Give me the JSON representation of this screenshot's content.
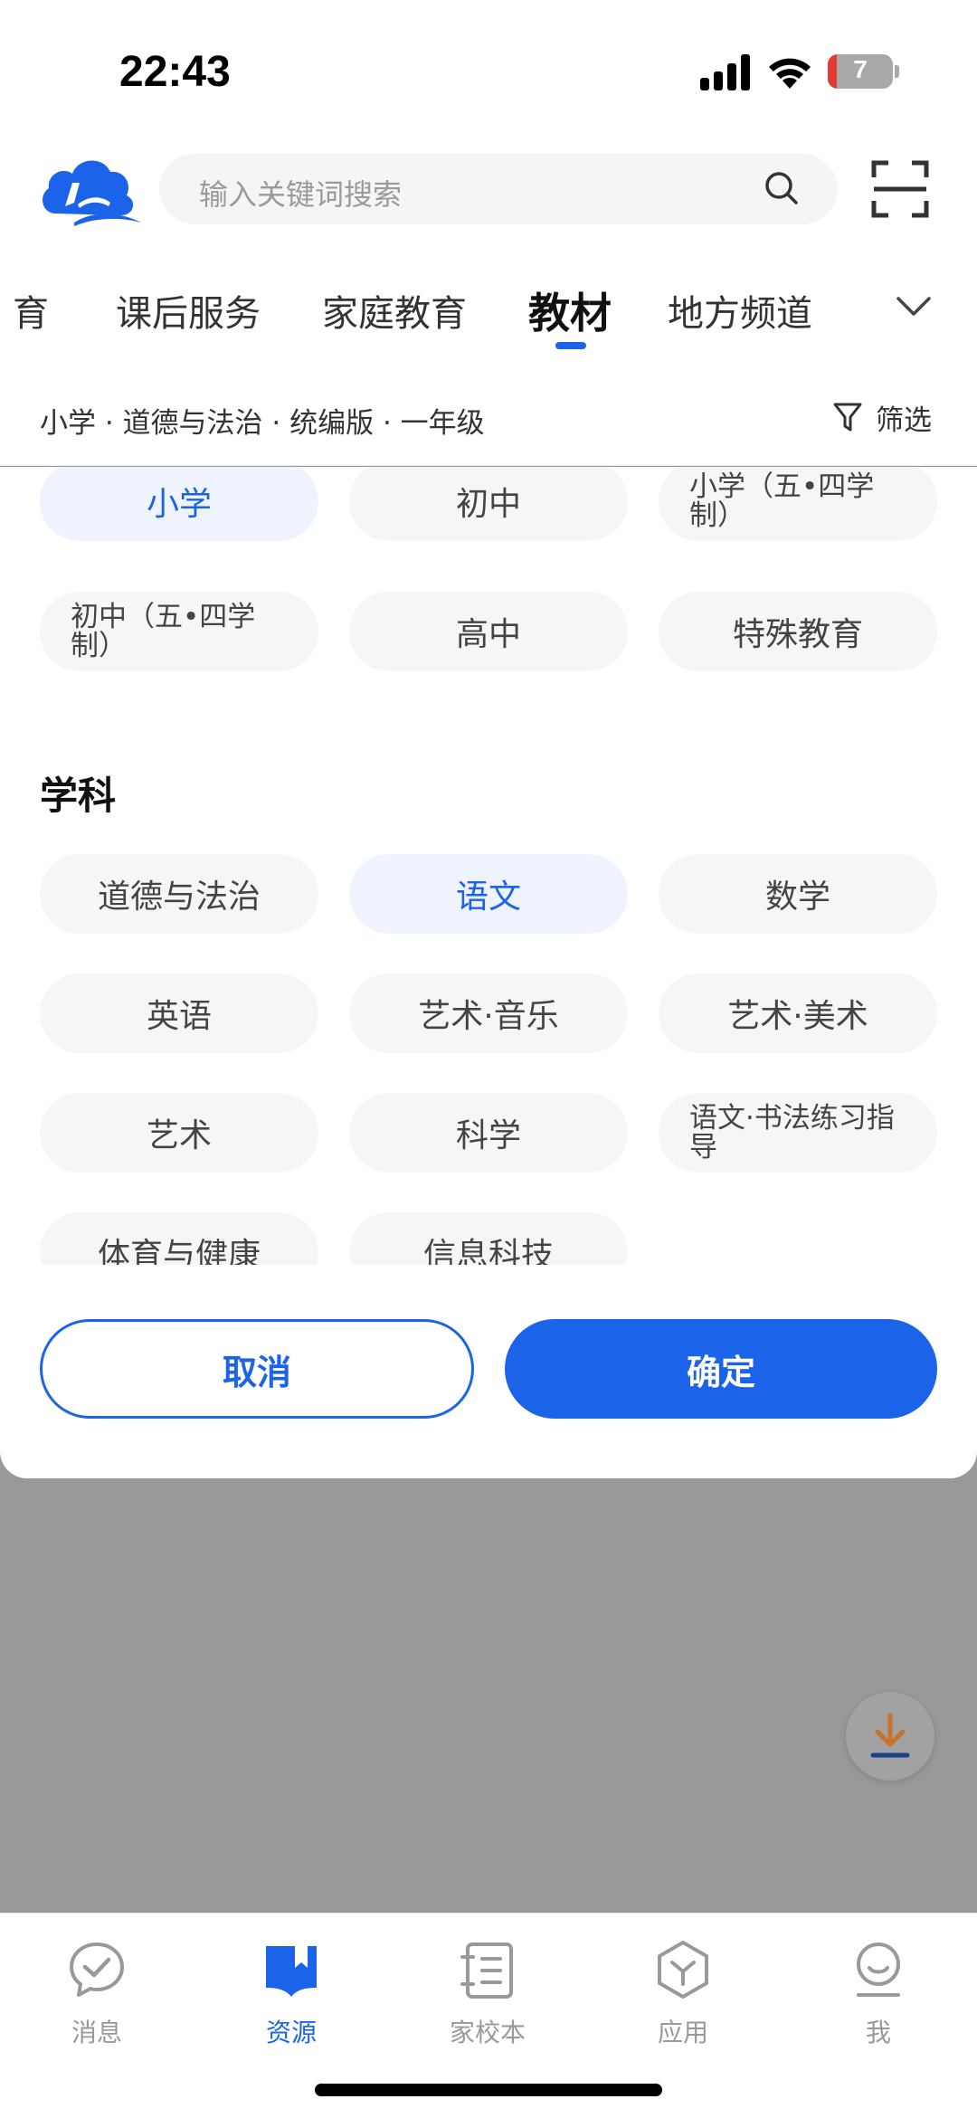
{
  "status_bar": {
    "time": "22:43",
    "battery": "7"
  },
  "search": {
    "placeholder": "输入关键词搜索"
  },
  "tabs": [
    {
      "label": "育"
    },
    {
      "label": "课后服务"
    },
    {
      "label": "家庭教育"
    },
    {
      "label": "教材",
      "active": true
    },
    {
      "label": "地方频道"
    }
  ],
  "filter": {
    "path": "小学 · 道德与法治 · 统编版 · 一年级",
    "label": "筛选"
  },
  "stage_options": [
    {
      "label": "小学",
      "selected": true
    },
    {
      "label": "初中"
    },
    {
      "label": "小学（五•四学制）"
    },
    {
      "label": "初中（五•四学制）"
    },
    {
      "label": "高中"
    },
    {
      "label": "特殊教育"
    }
  ],
  "subject_section": {
    "title": "学科"
  },
  "subject_options": [
    {
      "label": "道德与法治"
    },
    {
      "label": "语文",
      "selected": true
    },
    {
      "label": "数学"
    },
    {
      "label": "英语"
    },
    {
      "label": "艺术·音乐"
    },
    {
      "label": "艺术·美术"
    },
    {
      "label": "艺术"
    },
    {
      "label": "科学"
    },
    {
      "label": "语文·书法练习指导"
    },
    {
      "label": "体育与健康"
    },
    {
      "label": "信息科技"
    }
  ],
  "actions": {
    "cancel": "取消",
    "confirm": "确定"
  },
  "nav": [
    {
      "label": "消息",
      "icon": "message-check-icon"
    },
    {
      "label": "资源",
      "icon": "book-icon",
      "active": true
    },
    {
      "label": "家校本",
      "icon": "notebook-icon"
    },
    {
      "label": "应用",
      "icon": "apps-cube-icon"
    },
    {
      "label": "我",
      "icon": "profile-icon"
    }
  ],
  "colors": {
    "accent": "#1b64ea",
    "chip_bg": "#f6f6f7",
    "chip_selected_bg": "#eef3fe",
    "overlay": "#999999"
  }
}
